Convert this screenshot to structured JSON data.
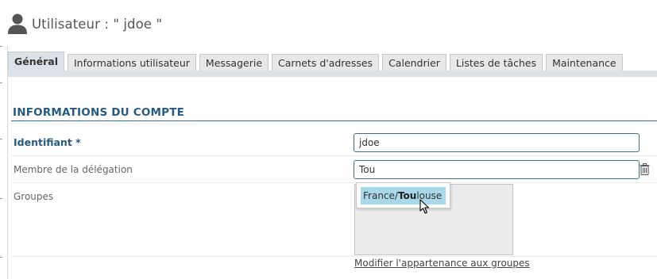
{
  "header": {
    "title": "Utilisateur : \" jdoe \"",
    "icon": "user-icon"
  },
  "tabs": [
    {
      "label": "Général",
      "active": true
    },
    {
      "label": "Informations utilisateur",
      "active": false
    },
    {
      "label": "Messagerie",
      "active": false
    },
    {
      "label": "Carnets d'adresses",
      "active": false
    },
    {
      "label": "Calendrier",
      "active": false
    },
    {
      "label": "Listes de tâches",
      "active": false
    },
    {
      "label": "Maintenance",
      "active": false
    }
  ],
  "section": {
    "title": "INFORMATIONS DU COMPTE"
  },
  "fields": {
    "login": {
      "label": "Identifiant *",
      "value": "jdoe"
    },
    "delegation": {
      "label": "Membre de la délégation",
      "value": "Tou"
    },
    "groups": {
      "label": "Groupes"
    }
  },
  "autocomplete": {
    "prefix": "France/",
    "match": "Tou",
    "suffix": "louse"
  },
  "links": {
    "modify_groups": "Modifier l'appartenance aux groupes"
  },
  "colors": {
    "accent": "#265a80",
    "highlight": "#a8d8ea",
    "tab_active": "#dce3e8"
  }
}
